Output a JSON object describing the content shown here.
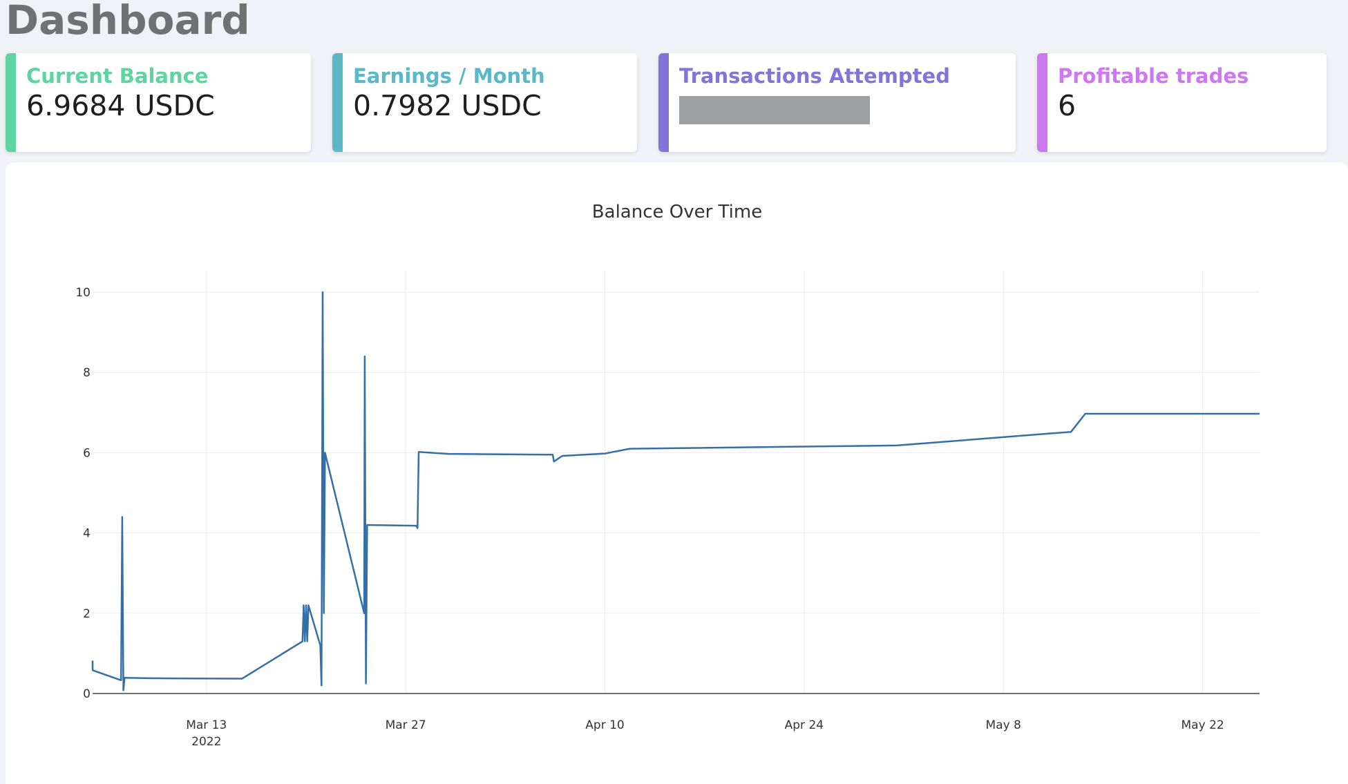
{
  "page": {
    "title": "Dashboard"
  },
  "cards": [
    {
      "label": "Current Balance",
      "value": "6.9684 USDC",
      "color": "#5fd4a0",
      "redacted": false
    },
    {
      "label": "Earnings / Month",
      "value": "0.7982 USDC",
      "color": "#5bb8c6",
      "redacted": false
    },
    {
      "label": "Transactions Attempted",
      "value": "",
      "color": "#8474d9",
      "redacted": true
    },
    {
      "label": "Profitable trades",
      "value": "6",
      "color": "#cd77f3",
      "redacted": false
    }
  ],
  "chart_data": {
    "type": "line",
    "title": "Balance Over Time",
    "xlabel": "",
    "ylabel": "",
    "line_color": "#346fa7",
    "ylim": [
      0,
      10.5
    ],
    "yticks": [
      0,
      2,
      4,
      6,
      8,
      10
    ],
    "xlim": [
      "2022-03-05",
      "2022-05-26"
    ],
    "xticks": [
      {
        "date": "2022-03-13",
        "label": "Mar 13",
        "sublabel": "2022"
      },
      {
        "date": "2022-03-27",
        "label": "Mar 27",
        "sublabel": ""
      },
      {
        "date": "2022-04-10",
        "label": "Apr 10",
        "sublabel": ""
      },
      {
        "date": "2022-04-24",
        "label": "Apr 24",
        "sublabel": ""
      },
      {
        "date": "2022-05-08",
        "label": "May 8",
        "sublabel": ""
      },
      {
        "date": "2022-05-22",
        "label": "May 22",
        "sublabel": ""
      }
    ],
    "grid": true,
    "series": [
      {
        "name": "",
        "points": [
          [
            "2022-03-05T00:00",
            0.82
          ],
          [
            "2022-03-05T00:10",
            0.58
          ],
          [
            "2022-03-07T00:00",
            0.33
          ],
          [
            "2022-03-07T02:00",
            4.4
          ],
          [
            "2022-03-07T04:00",
            0.08
          ],
          [
            "2022-03-07T06:00",
            0.39
          ],
          [
            "2022-03-09T00:00",
            0.38
          ],
          [
            "2022-03-15T12:00",
            0.37
          ],
          [
            "2022-03-19T18:00",
            1.3
          ],
          [
            "2022-03-19T20:00",
            2.2
          ],
          [
            "2022-03-19T22:00",
            1.3
          ],
          [
            "2022-03-20T00:00",
            2.2
          ],
          [
            "2022-03-20T02:00",
            1.3
          ],
          [
            "2022-03-20T04:00",
            2.2
          ],
          [
            "2022-03-21T00:00",
            1.2
          ],
          [
            "2022-03-21T02:00",
            0.2
          ],
          [
            "2022-03-21T04:00",
            10.0
          ],
          [
            "2022-03-21T06:00",
            2.0
          ],
          [
            "2022-03-21T08:00",
            6.0
          ],
          [
            "2022-03-24T02:00",
            2.0
          ],
          [
            "2022-03-24T03:00",
            8.4
          ],
          [
            "2022-03-24T05:00",
            0.25
          ],
          [
            "2022-03-24T07:00",
            4.2
          ],
          [
            "2022-03-27T18:00",
            4.18
          ],
          [
            "2022-03-27T20:00",
            4.12
          ],
          [
            "2022-03-27T22:00",
            6.02
          ],
          [
            "2022-03-30T00:00",
            5.97
          ],
          [
            "2022-04-06T08:00",
            5.95
          ],
          [
            "2022-04-06T10:00",
            5.78
          ],
          [
            "2022-04-07T00:00",
            5.92
          ],
          [
            "2022-04-10T00:00",
            5.98
          ],
          [
            "2022-04-11T18:00",
            6.1
          ],
          [
            "2022-04-30T12:00",
            6.18
          ],
          [
            "2022-05-12T18:00",
            6.52
          ],
          [
            "2022-05-13T18:00",
            6.97
          ],
          [
            "2022-05-26T00:00",
            6.97
          ]
        ]
      }
    ]
  }
}
